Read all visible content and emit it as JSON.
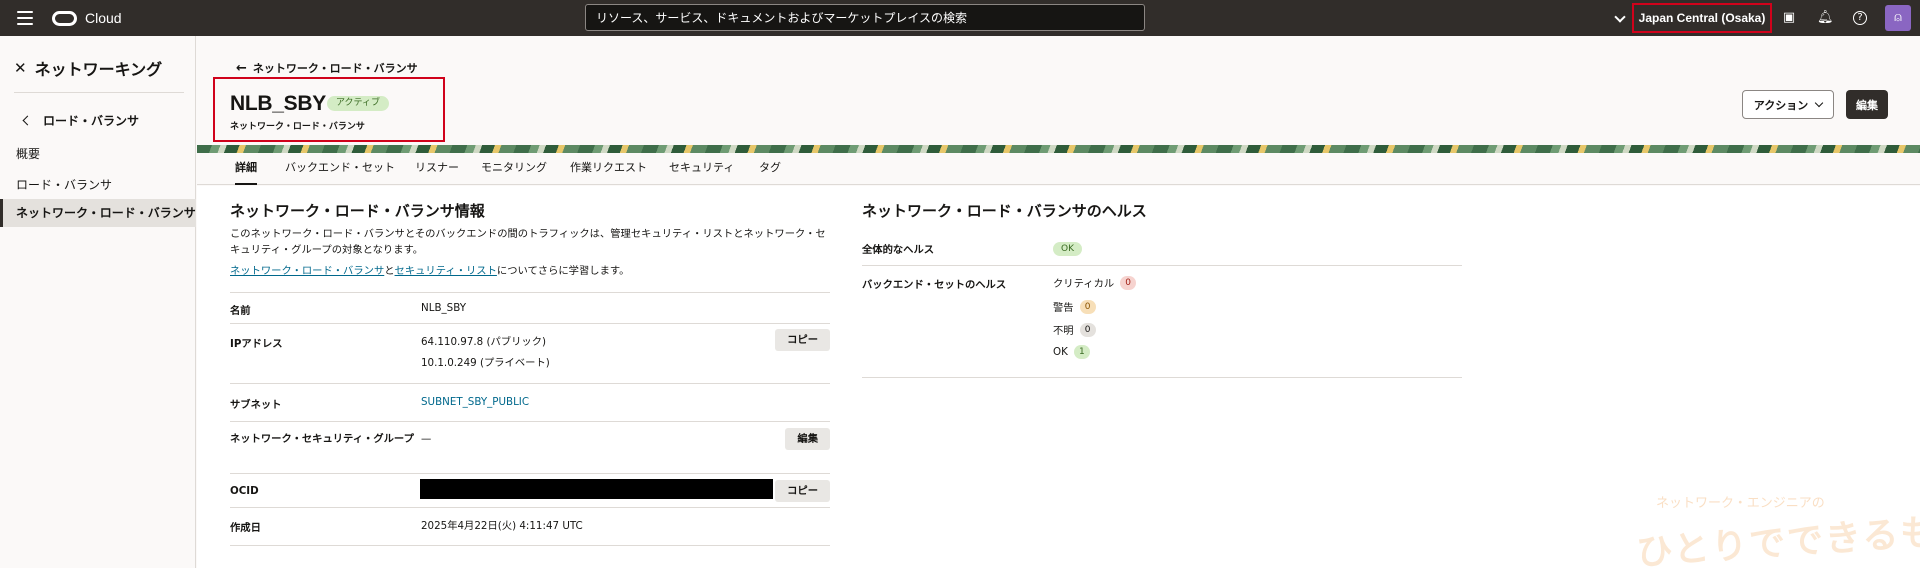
{
  "topbar": {
    "brand": "Cloud",
    "search_placeholder": "リソース、サービス、ドキュメントおよびマーケットプレイスの検索",
    "region": "Japan Central (Osaka)"
  },
  "leftnav": {
    "title": "ネットワーキング",
    "back_label": "ロード・バランサ",
    "items": [
      {
        "label": "概要"
      },
      {
        "label": "ロード・バランサ"
      },
      {
        "label": "ネットワーク・ロード・バランサ",
        "active": true
      }
    ]
  },
  "header": {
    "back_label": "ネットワーク・ロード・バランサ",
    "title": "NLB_SBY",
    "status": "アクティブ",
    "subtitle": "ネットワーク・ロード・バランサ",
    "action_label": "アクション",
    "edit_label": "編集"
  },
  "tabs": [
    "詳細",
    "バックエンド・セット",
    "リスナー",
    "モニタリング",
    "作業リクエスト",
    "セキュリティ",
    "タグ"
  ],
  "info": {
    "title": "ネットワーク・ロード・バランサ情報",
    "description": "このネットワーク・ロード・バランサとそのバックエンドの間のトラフィックは、管理セキュリティ・リストとネットワーク・セキュリティ・グループの対象となります。",
    "learn_link1": "ネットワーク・ロード・バランサ",
    "learn_and": "と",
    "learn_link2": "セキュリティ・リスト",
    "learn_suffix": "についてさらに学習します。",
    "rows": {
      "name_label": "名前",
      "name_value": "NLB_SBY",
      "ip_label": "IPアドレス",
      "ip_public": "64.110.97.8 (パブリック)",
      "ip_private": "10.1.0.249 (プライベート)",
      "copy_label": "コピー",
      "subnet_label": "サブネット",
      "subnet_value": "SUBNET_SBY_PUBLIC",
      "nsg_label": "ネットワーク・セキュリティ・グループ",
      "nsg_value": "—",
      "nsg_edit_label": "編集",
      "ocid_label": "OCID",
      "created_label": "作成日",
      "created_value": "2025年4月22日(火) 4:11:47 UTC"
    }
  },
  "health": {
    "title": "ネットワーク・ロード・バランサのヘルス",
    "overall_label": "全体的なヘルス",
    "overall_value": "OK",
    "backend_label": "バックエンド・セットのヘルス",
    "items": [
      {
        "label": "クリティカル",
        "count": "0"
      },
      {
        "label": "警告",
        "count": "0"
      },
      {
        "label": "不明",
        "count": "0"
      },
      {
        "label": "OK",
        "count": "1"
      }
    ]
  },
  "watermark": {
    "sub": "ネットワーク・エンジニアの",
    "main": "ひとりでできるもん"
  },
  "colors": {
    "topbar": "#312d2a",
    "highlight": "#d0021b",
    "link": "#00688c",
    "ok_bg": "#d4ecc5"
  }
}
